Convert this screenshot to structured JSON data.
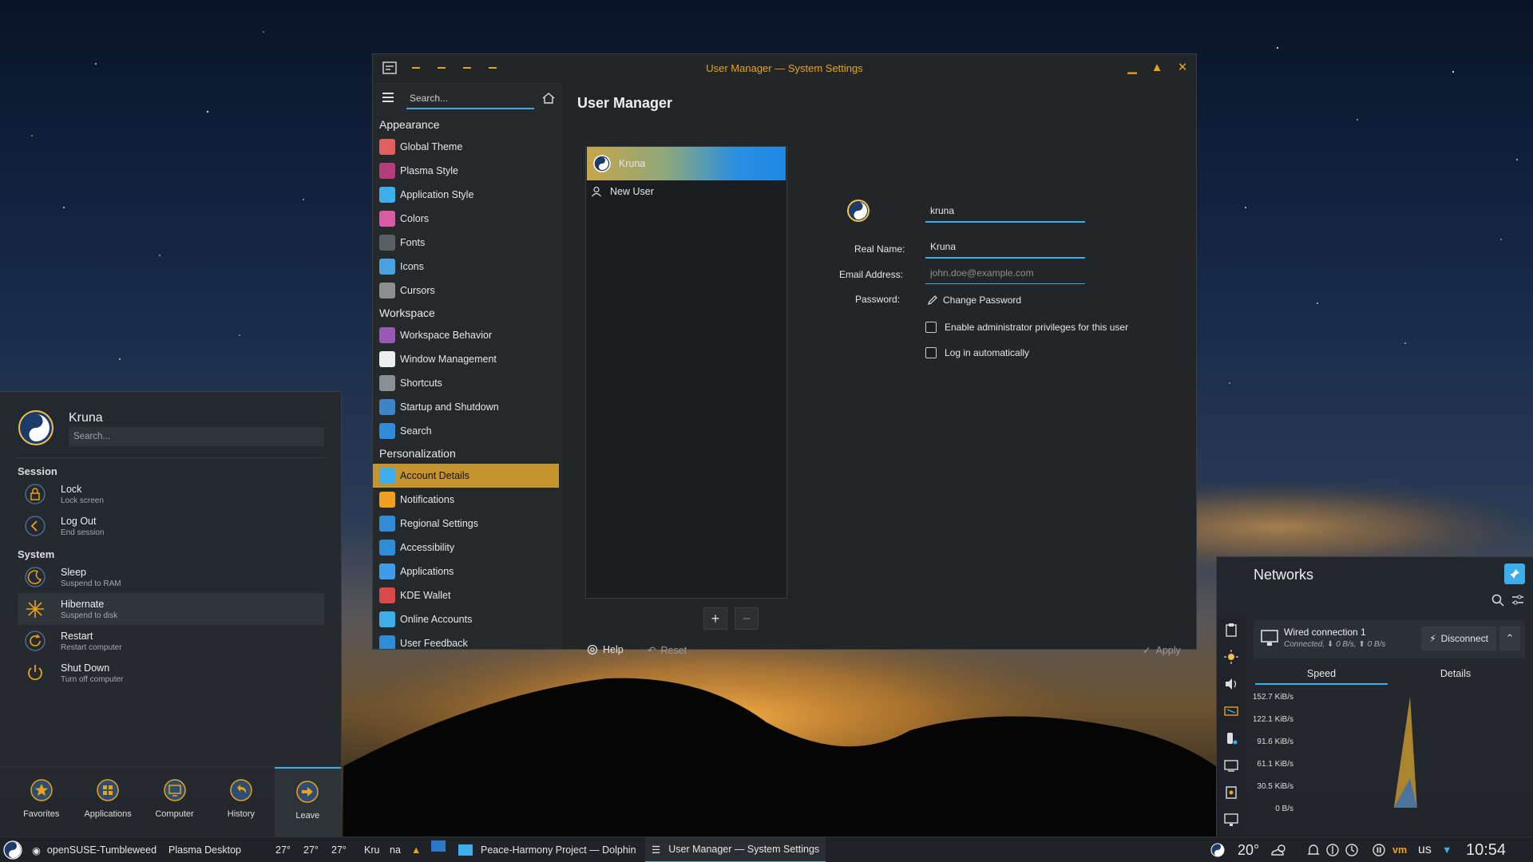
{
  "colors": {
    "accent": "#3daee9",
    "brand_gold": "#e8a317",
    "active_item": "#c6942d",
    "chart_fill": "#b8912e"
  },
  "window": {
    "title": "User Manager — System Settings",
    "search_placeholder": "Search...",
    "categories": [
      {
        "title": "Appearance",
        "items": [
          {
            "label": "Global Theme",
            "icon": "global-theme-icon"
          },
          {
            "label": "Plasma Style",
            "icon": "plasma-style-icon"
          },
          {
            "label": "Application Style",
            "icon": "application-style-icon"
          },
          {
            "label": "Colors",
            "icon": "colors-icon"
          },
          {
            "label": "Fonts",
            "icon": "fonts-icon"
          },
          {
            "label": "Icons",
            "icon": "icons-icon"
          },
          {
            "label": "Cursors",
            "icon": "cursors-icon"
          }
        ]
      },
      {
        "title": "Workspace",
        "items": [
          {
            "label": "Workspace Behavior",
            "icon": "workspace-behavior-icon"
          },
          {
            "label": "Window Management",
            "icon": "window-management-icon"
          },
          {
            "label": "Shortcuts",
            "icon": "keyboard-icon"
          },
          {
            "label": "Startup and Shutdown",
            "icon": "startup-icon"
          },
          {
            "label": "Search",
            "icon": "search-icon"
          }
        ]
      },
      {
        "title": "Personalization",
        "items": [
          {
            "label": "Account Details",
            "icon": "account-icon"
          },
          {
            "label": "Notifications",
            "icon": "bell-icon"
          },
          {
            "label": "Regional Settings",
            "icon": "regional-icon"
          },
          {
            "label": "Accessibility",
            "icon": "accessibility-icon"
          },
          {
            "label": "Applications",
            "icon": "applications-icon"
          },
          {
            "label": "KDE Wallet",
            "icon": "wallet-icon"
          },
          {
            "label": "Online Accounts",
            "icon": "globe-icon"
          },
          {
            "label": "User Feedback",
            "icon": "feedback-icon"
          }
        ]
      }
    ],
    "page_title": "User Manager",
    "users": [
      {
        "label": "Kruna"
      },
      {
        "label": "New User"
      }
    ],
    "add_label": "+",
    "remove_label": "−",
    "form": {
      "username_value": "kruna",
      "real_name_label": "Real Name:",
      "real_name_value": "Kruna",
      "email_label": "Email Address:",
      "email_placeholder": "john.doe@example.com",
      "password_label": "Password:",
      "change_password": "Change Password",
      "admin_checkbox": "Enable administrator privileges for this user",
      "autologin_checkbox": "Log in automatically"
    },
    "footer": {
      "help": "Help",
      "reset": "Reset",
      "apply": "Apply"
    }
  },
  "launcher": {
    "username": "Kruna",
    "search_placeholder": "Search...",
    "session_title": "Session",
    "system_title": "System",
    "session_items": [
      {
        "title": "Lock",
        "subtitle": "Lock screen"
      },
      {
        "title": "Log Out",
        "subtitle": "End session"
      }
    ],
    "system_items": [
      {
        "title": "Sleep",
        "subtitle": "Suspend to RAM"
      },
      {
        "title": "Hibernate",
        "subtitle": "Suspend to disk"
      },
      {
        "title": "Restart",
        "subtitle": "Restart computer"
      },
      {
        "title": "Shut Down",
        "subtitle": "Turn off computer"
      }
    ],
    "tabs": [
      "Favorites",
      "Applications",
      "Computer",
      "History",
      "Leave"
    ]
  },
  "networks": {
    "title": "Networks",
    "connection_name": "Wired connection 1",
    "connection_status": "Connected, ⬇ 0 B/s, ⬆ 0 B/s",
    "disconnect_label": "Disconnect",
    "tabs": [
      "Speed",
      "Details"
    ]
  },
  "chart_data": {
    "type": "area",
    "title": "",
    "y_ticks": [
      "152.7 KiB/s",
      "122.1 KiB/s",
      "91.6 KiB/s",
      "61.1 KiB/s",
      "30.5 KiB/s",
      "0 B/s"
    ],
    "ylim": [
      0,
      152.7
    ],
    "x": [
      0,
      1,
      2,
      3,
      4,
      5,
      6,
      7,
      8,
      9,
      10,
      11,
      12,
      13,
      14,
      15,
      16,
      17,
      18,
      19
    ],
    "series": [
      {
        "values": [
          0,
          0,
          0,
          0,
          0,
          0,
          0,
          0,
          0,
          0,
          0,
          0,
          0,
          0,
          0,
          0,
          0,
          0,
          0,
          0
        ]
      },
      {
        "values": [
          0,
          0,
          0,
          0,
          0,
          0,
          0,
          0,
          0,
          0,
          0,
          0,
          0,
          0,
          0,
          0,
          0,
          0,
          0,
          0
        ]
      }
    ],
    "spike_index": 9,
    "spike_values": [
      152,
      40
    ],
    "grid": false
  },
  "taskbar": {
    "distro": "openSUSE-Tumbleweed",
    "desktop": "Plasma Desktop",
    "temps": [
      "27°",
      "27°",
      "27°"
    ],
    "user_parts": [
      "Kru",
      "na"
    ],
    "tasks": [
      {
        "label": "Peace-Harmony Project — Dolphin"
      },
      {
        "label": "User Manager — System Settings"
      }
    ],
    "weather_temp": "20°",
    "keyboard_layout": "us",
    "clock": "10:54"
  }
}
